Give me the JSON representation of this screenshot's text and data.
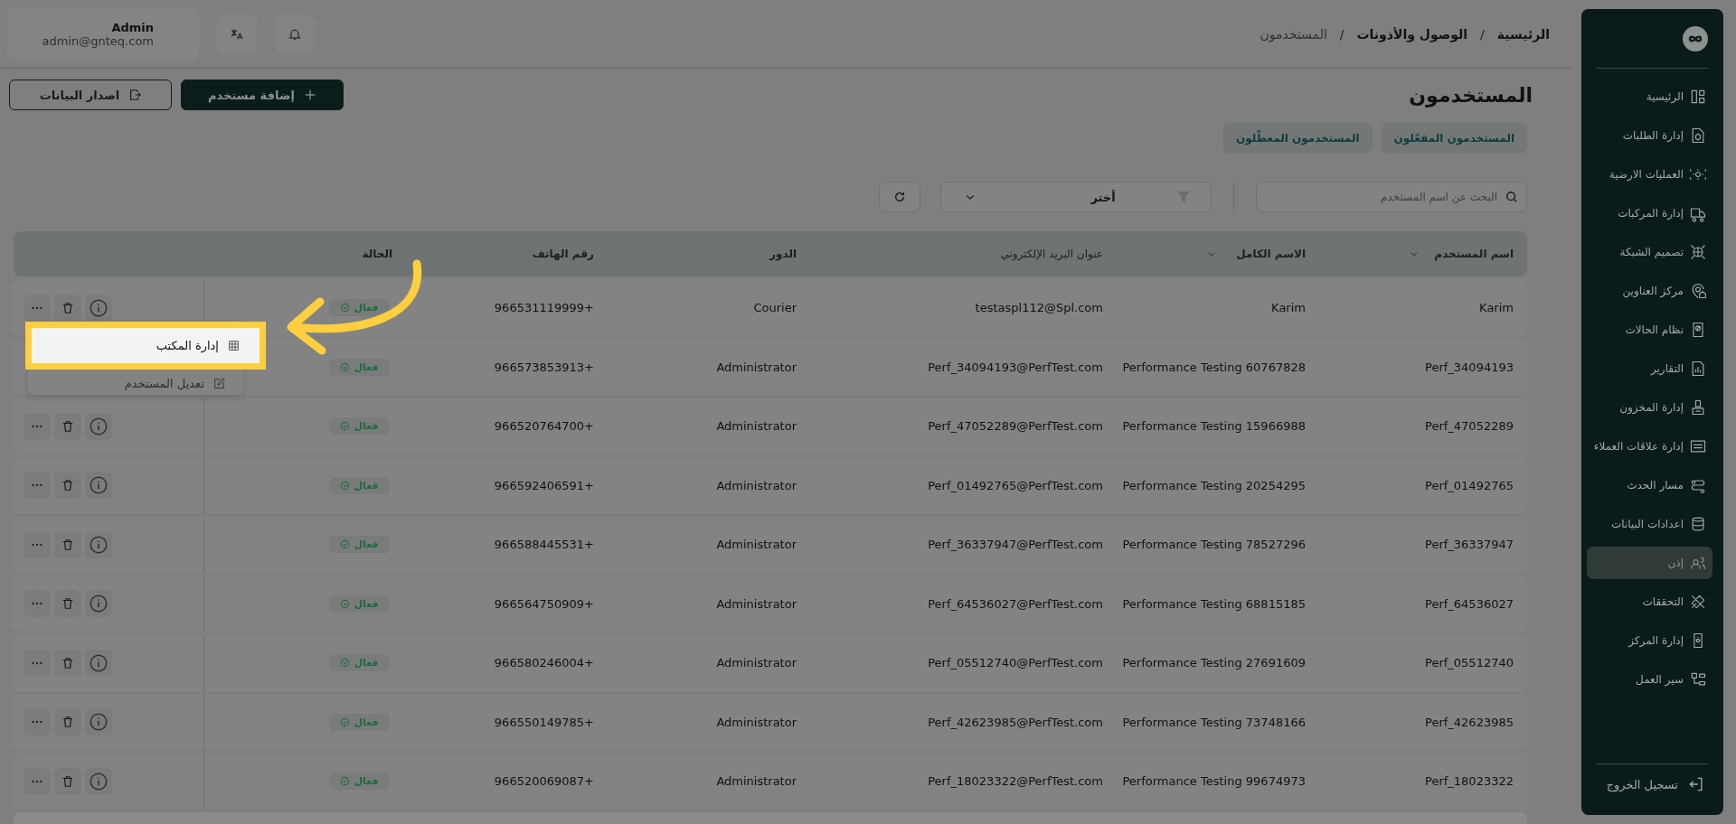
{
  "breadcrumb": {
    "separator": "/",
    "items": [
      {
        "label": "الرئيسية",
        "current": false
      },
      {
        "label": "الوصول والأذونات",
        "current": false
      },
      {
        "label": "المستخدمون",
        "current": true
      }
    ]
  },
  "account": {
    "name": "Admin",
    "email": "admin@gnteq.com"
  },
  "page_title": "المستخدمون",
  "buttons": [
    {
      "label": "إضافة مستخدم",
      "kind": "primary"
    },
    {
      "label": "اصدار البيانات",
      "kind": "export"
    }
  ],
  "tabs": [
    {
      "label": "المستخدمون المفعّلون"
    },
    {
      "label": "المستخدمون المعطّلون"
    }
  ],
  "search": {
    "placeholder": "البحث عن اسم المستخدم"
  },
  "filter": {
    "value": "أختر"
  },
  "table": {
    "columns": [
      {
        "label": "اسم المستخدم",
        "sortable": true
      },
      {
        "label": "الاسم الكامل",
        "sortable": true
      },
      {
        "label": "عنوان البريد الإلكتروني",
        "sortable": false
      },
      {
        "label": "الدور",
        "sortable": false
      },
      {
        "label": "رقم الهاتف",
        "sortable": false
      },
      {
        "label": "الحالة",
        "sortable": false
      }
    ],
    "rows": [
      {
        "username": "Karim",
        "full_name": "Karim",
        "email": "testaspl112@Spl.com",
        "role": "Courier",
        "phone": "966531119999+",
        "status": "فعال"
      },
      {
        "username": "Perf_34094193",
        "full_name": "Performance Testing 60767828",
        "email": "Perf_34094193@PerfTest.com",
        "role": "Administrator",
        "phone": "966573853913+",
        "status": "فعال"
      },
      {
        "username": "Perf_47052289",
        "full_name": "Performance Testing 15966988",
        "email": "Perf_47052289@PerfTest.com",
        "role": "Administrator",
        "phone": "966520764700+",
        "status": "فعال"
      },
      {
        "username": "Perf_01492765",
        "full_name": "Performance Testing 20254295",
        "email": "Perf_01492765@PerfTest.com",
        "role": "Administrator",
        "phone": "966592406591+",
        "status": "فعال"
      },
      {
        "username": "Perf_36337947",
        "full_name": "Performance Testing 78527296",
        "email": "Perf_36337947@PerfTest.com",
        "role": "Administrator",
        "phone": "966588445531+",
        "status": "فعال"
      },
      {
        "username": "Perf_64536027",
        "full_name": "Performance Testing 68815185",
        "email": "Perf_64536027@PerfTest.com",
        "role": "Administrator",
        "phone": "966564750909+",
        "status": "فعال"
      },
      {
        "username": "Perf_05512740",
        "full_name": "Performance Testing 27691609",
        "email": "Perf_05512740@PerfTest.com",
        "role": "Administrator",
        "phone": "966580246004+",
        "status": "فعال"
      },
      {
        "username": "Perf_42623985",
        "full_name": "Performance Testing 73748166",
        "email": "Perf_42623985@PerfTest.com",
        "role": "Administrator",
        "phone": "966550149785+",
        "status": "فعال"
      },
      {
        "username": "Perf_18023322",
        "full_name": "Performance Testing 99674973",
        "email": "Perf_18023322@PerfTest.com",
        "role": "Administrator",
        "phone": "966520069087+",
        "status": "فعال"
      }
    ]
  },
  "row_menu": [
    {
      "label": "إدارة المكتب",
      "highlighted": true
    },
    {
      "label": "تعديل المستخدم",
      "highlighted": false
    }
  ],
  "sidebar": {
    "items": [
      {
        "label": "الرئيسية",
        "selected": false
      },
      {
        "label": "إدارة الطلبات",
        "selected": false
      },
      {
        "label": "العمليات الارضية",
        "selected": false
      },
      {
        "label": "إدارة المركبات",
        "selected": false
      },
      {
        "label": "تصميم الشبكة",
        "selected": false
      },
      {
        "label": "مركز العناوين",
        "selected": false
      },
      {
        "label": "نظام الحالات",
        "selected": false
      },
      {
        "label": "التقارير",
        "selected": false
      },
      {
        "label": "إدارة المخزون",
        "selected": false
      },
      {
        "label": "إدارة علاقات العملاء",
        "selected": false
      },
      {
        "label": "مسار الحدث",
        "selected": false
      },
      {
        "label": "اعدادات البيانات",
        "selected": false
      },
      {
        "label": "إذن",
        "selected": true
      },
      {
        "label": "التحققات",
        "selected": false
      },
      {
        "label": "إدارة المركز",
        "selected": false
      },
      {
        "label": "سير العمل",
        "selected": false
      }
    ],
    "logout": "تسجيل الخروج"
  }
}
